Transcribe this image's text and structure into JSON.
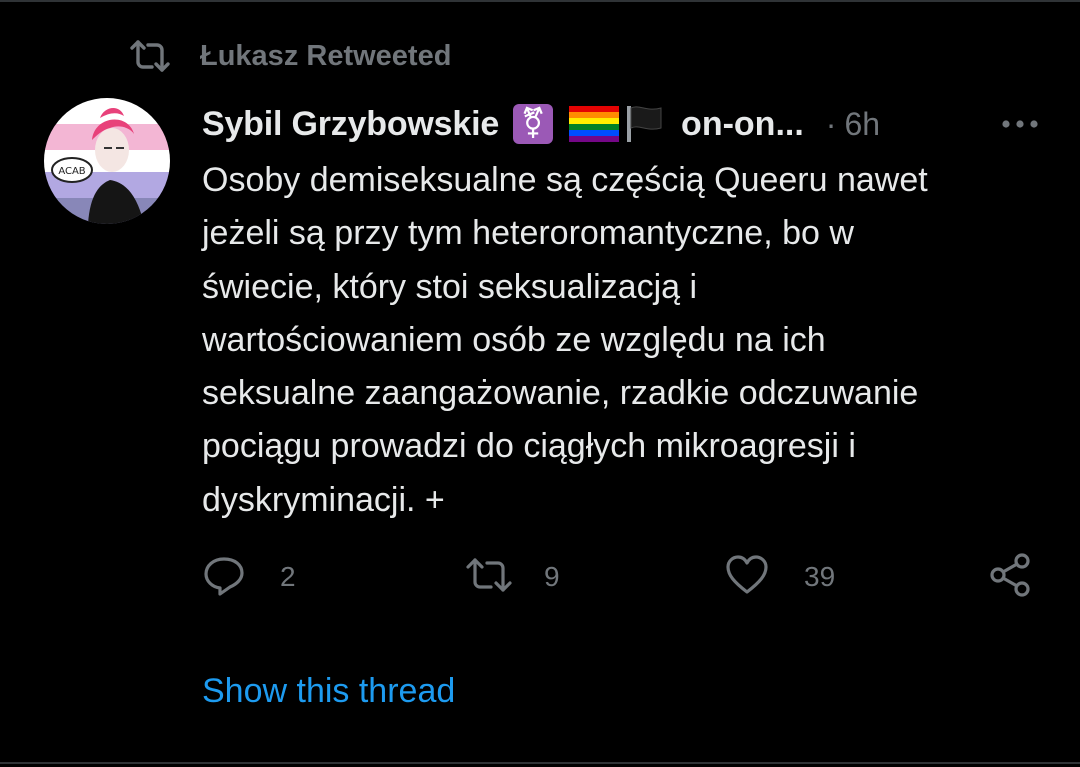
{
  "retweet": {
    "label": "Łukasz Retweeted",
    "icon": "retweet-icon"
  },
  "tweet": {
    "avatar_icon": "avatar",
    "author_name": "Sybil Grzybowskie",
    "name_emojis": [
      "⚧️",
      "🏳️‍🌈",
      "🏴"
    ],
    "name_truncated": "on-on...",
    "separator": "·",
    "time": "6h",
    "more_icon": "more-dots-icon",
    "text_lines": [
      "Osoby demiseksualne są częścią Queeru nawet",
      "jeżeli są przy tym heteroromantyczne, bo w",
      "świecie, który stoi seksualizacją i",
      "wartościowaniem osób ze względu na ich",
      "seksualne zaangażowanie, rzadkie odczuwanie",
      "pociągu prowadzi do ciągłych mikroagresji i",
      "dyskryminacji. +"
    ]
  },
  "actions": {
    "reply": {
      "icon": "reply-icon",
      "count": "2"
    },
    "retweet": {
      "icon": "retweet-icon",
      "count": "9"
    },
    "like": {
      "icon": "heart-icon",
      "count": "39"
    },
    "share": {
      "icon": "share-icon"
    }
  },
  "show_thread_label": "Show this thread",
  "colors": {
    "background": "#000000",
    "text_primary": "#e7e9ea",
    "text_secondary": "#71767b",
    "link": "#1d9bf0",
    "divider": "#2f3336"
  }
}
